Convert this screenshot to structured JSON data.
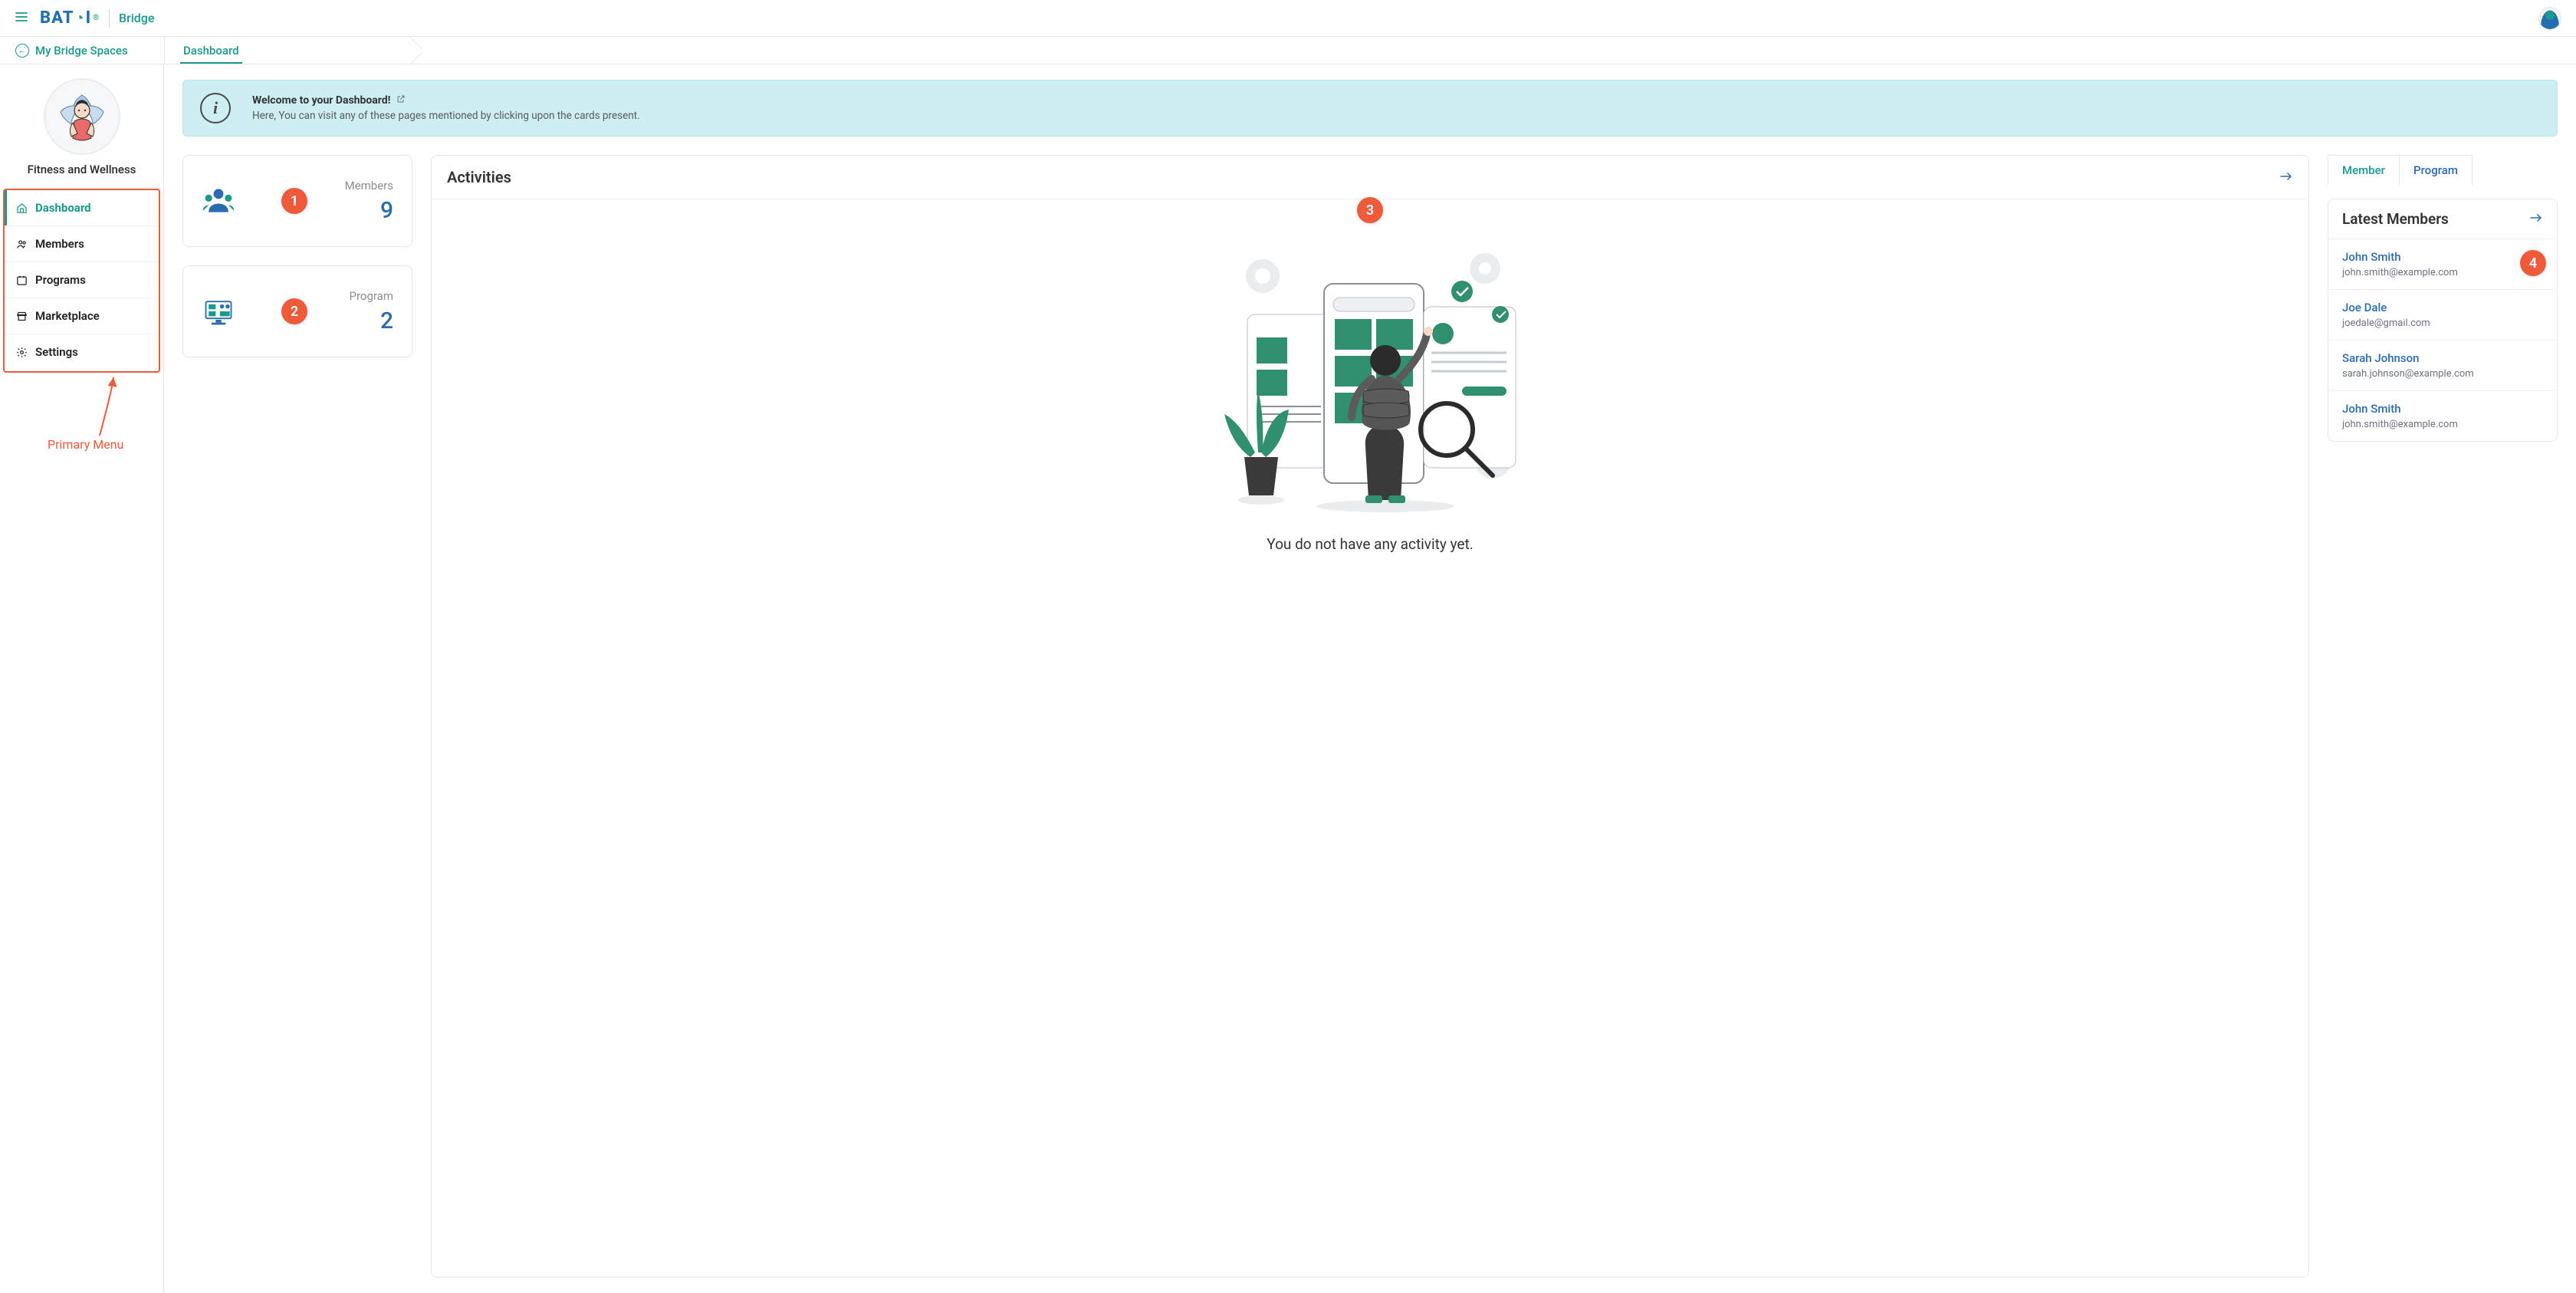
{
  "header": {
    "app_name": "Bridge",
    "logo_text": "BATOI"
  },
  "subbar": {
    "back_label": "My Bridge Spaces",
    "crumb": "Dashboard"
  },
  "sidebar": {
    "space_name": "Fitness and Wellness",
    "items": [
      {
        "label": "Dashboard",
        "icon": "home",
        "active": true
      },
      {
        "label": "Members",
        "icon": "users"
      },
      {
        "label": "Programs",
        "icon": "calendar"
      },
      {
        "label": "Marketplace",
        "icon": "store"
      },
      {
        "label": "Settings",
        "icon": "gear"
      }
    ]
  },
  "annotation": {
    "primary_menu_label": "Primary Menu",
    "badges": [
      "1",
      "2",
      "3",
      "4"
    ]
  },
  "welcome": {
    "title": "Welcome to your Dashboard!",
    "body": "Here, You can visit any of these pages mentioned by clicking upon the cards present."
  },
  "stats": [
    {
      "label": "Members",
      "value": "9",
      "icon": "members"
    },
    {
      "label": "Program",
      "value": "2",
      "icon": "program"
    }
  ],
  "activities": {
    "title": "Activities",
    "empty_text": "You do not have any activity yet."
  },
  "rightcol": {
    "tabs": [
      "Member",
      "Program"
    ],
    "latest_title": "Latest Members",
    "members": [
      {
        "name": "John Smith",
        "email": "john.smith@example.com"
      },
      {
        "name": "Joe Dale",
        "email": "joedale@gmail.com"
      },
      {
        "name": "Sarah Johnson",
        "email": "sarah.johnson@example.com"
      },
      {
        "name": "John Smith",
        "email": "john.smith@example.com"
      }
    ]
  }
}
